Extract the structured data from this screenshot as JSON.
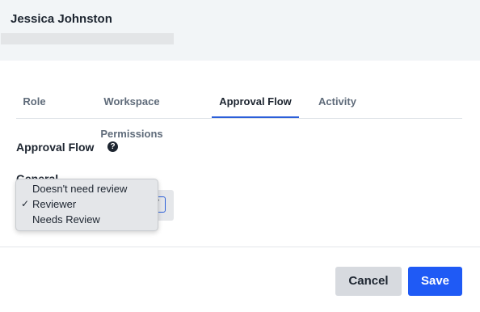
{
  "header": {
    "user_name": "Jessica Johnston"
  },
  "tabs": [
    {
      "label": "Role",
      "active": false
    },
    {
      "label": "Workspace Permissions",
      "active": false
    },
    {
      "label": "Approval Flow",
      "active": true
    },
    {
      "label": "Activity",
      "active": false
    }
  ],
  "section": {
    "title": "Approval Flow",
    "help_icon": "question-circle-icon",
    "general_label": "General"
  },
  "dropdown": {
    "options": [
      {
        "label": "Doesn't need review",
        "selected": false
      },
      {
        "label": "Reviewer",
        "selected": true
      },
      {
        "label": "Needs Review",
        "selected": false
      }
    ],
    "check_mark": "✓"
  },
  "footer": {
    "cancel_label": "Cancel",
    "save_label": "Save"
  },
  "colors": {
    "accent": "#2c5fd9",
    "save_button": "#1f5af5",
    "header_bg": "#f2f5f7"
  }
}
